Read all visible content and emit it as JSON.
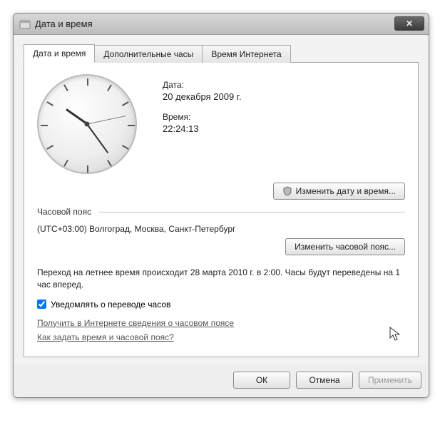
{
  "window": {
    "title": "Дата и время"
  },
  "tabs": [
    {
      "label": "Дата и время"
    },
    {
      "label": "Дополнительные часы"
    },
    {
      "label": "Время Интернета"
    }
  ],
  "datetime": {
    "date_label": "Дата:",
    "date_value": "20 декабря 2009 г.",
    "time_label": "Время:",
    "time_value": "22:24:13",
    "change_button": "Изменить дату и время..."
  },
  "timezone": {
    "section_label": "Часовой пояс",
    "value": "(UTC+03:00) Волгоград, Москва, Санкт-Петербург",
    "change_button": "Изменить часовой пояс..."
  },
  "dst": {
    "text": "Переход на летнее время происходит 28 марта 2010 г. в 2:00. Часы будут переведены на 1 час вперед.",
    "notify_label": "Уведомлять о переводе часов",
    "notify_checked": true
  },
  "links": {
    "tzinfo": "Получить в Интернете сведения о часовом поясе",
    "howto": "Как задать время и часовой пояс?"
  },
  "footer": {
    "ok": "ОК",
    "cancel": "Отмена",
    "apply": "Применить"
  }
}
